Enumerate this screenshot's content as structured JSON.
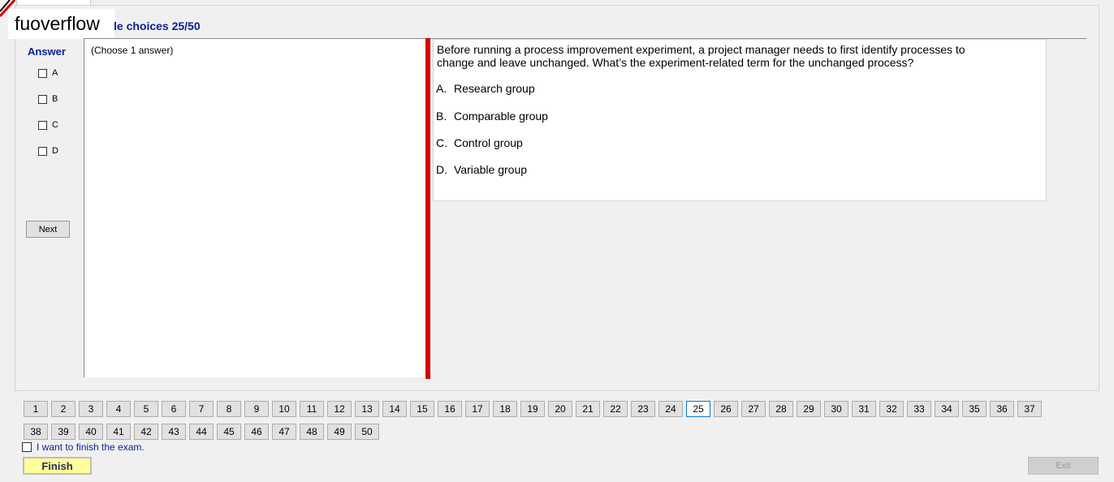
{
  "header": {
    "watermark": "fuoverflow",
    "section_title": "le choices 25/50"
  },
  "answer_panel": {
    "label": "Answer",
    "options": [
      "A",
      "B",
      "C",
      "D"
    ],
    "next_label": "Next"
  },
  "left_pane": {
    "instruction": "(Choose 1 answer)"
  },
  "question": {
    "text": "Before running a process improvement experiment, a project manager needs to first identify processes to change and leave unchanged. What’s the experiment-related term for the unchanged process?",
    "choices": [
      {
        "letter": "A.",
        "text": "Research group"
      },
      {
        "letter": "B.",
        "text": "Comparable group"
      },
      {
        "letter": "C.",
        "text": "Control group"
      },
      {
        "letter": "D.",
        "text": "Variable group"
      }
    ]
  },
  "navigation": {
    "current": 25,
    "row1": [
      "1",
      "2",
      "3",
      "4",
      "5",
      "6",
      "7",
      "8",
      "9",
      "10",
      "11",
      "12",
      "13",
      "14",
      "15",
      "16",
      "17",
      "18",
      "19",
      "20",
      "21",
      "22",
      "23",
      "24",
      "25",
      "26",
      "27",
      "28",
      "29",
      "30",
      "31",
      "32",
      "33",
      "34",
      "35",
      "36",
      "37"
    ],
    "row2": [
      "38",
      "39",
      "40",
      "41",
      "42",
      "43",
      "44",
      "45",
      "46",
      "47",
      "48",
      "49",
      "50"
    ]
  },
  "footer": {
    "finish_check_label": "I want to finish the exam.",
    "finish_label": "Finish",
    "exit_label": "Exit"
  },
  "colors": {
    "title_blue": "#0b1f9c",
    "splitter_red": "#d20000",
    "finish_yellow": "#ffff9a"
  }
}
